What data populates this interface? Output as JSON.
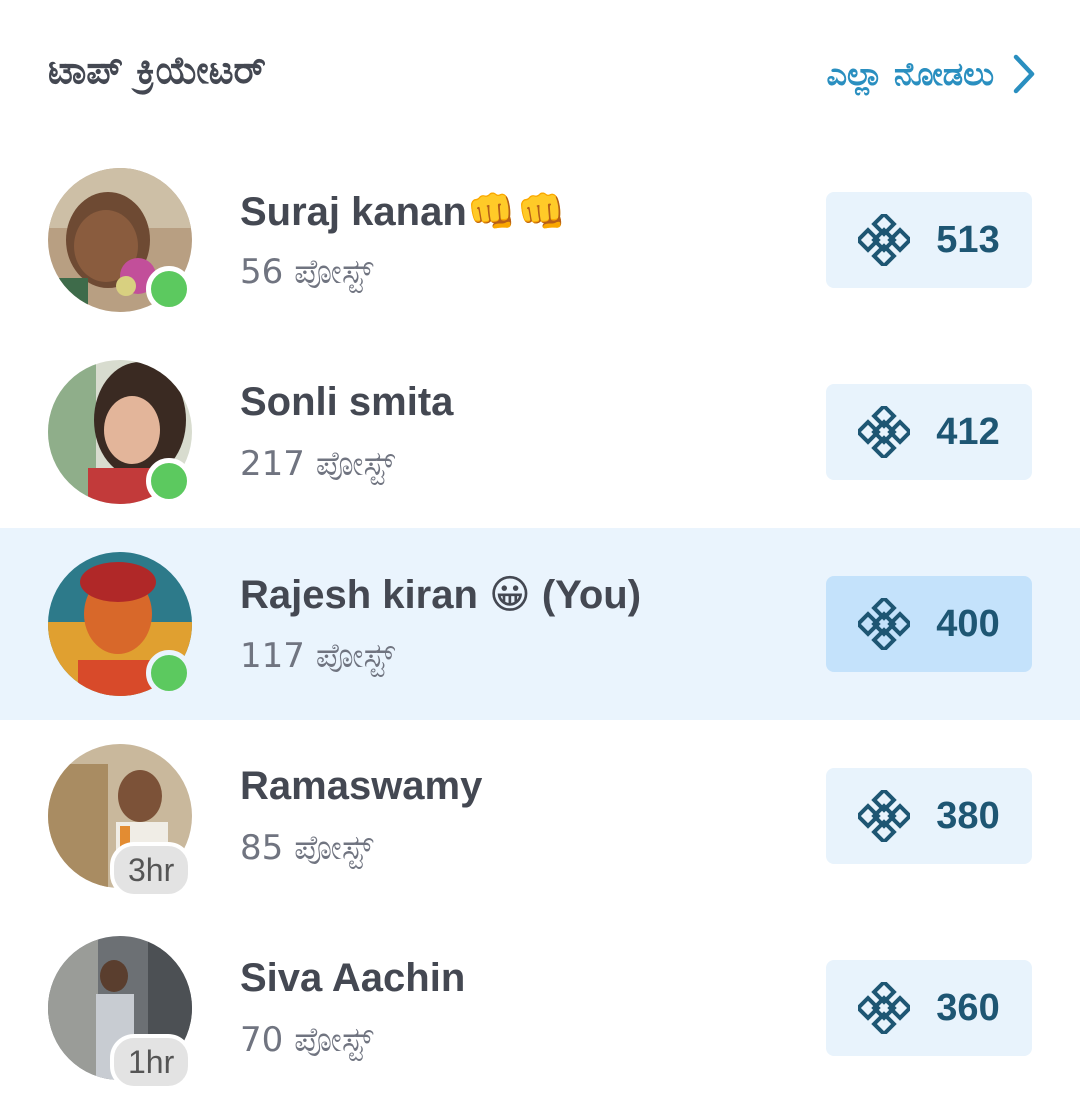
{
  "header": {
    "title": "ಟಾಪ್ ಕ್ರಿಯೇಟರ್",
    "see_all_label": "ಎಲ್ಲಾ ನೋಡಲು",
    "chevron_icon": "chevron-right-icon",
    "accent_color": "#2a8fc0"
  },
  "creators": [
    {
      "name": "Suraj kanan👊👊",
      "posts": "56 ಪೋಸ್ಟ್",
      "points": "513",
      "status": "online",
      "highlight": false
    },
    {
      "name": "Sonli smita",
      "posts": "217 ಪೋಸ್ಟ್",
      "points": "412",
      "status": "online",
      "highlight": false
    },
    {
      "name": "Rajesh kiran 😀 (You)",
      "posts": "117 ಪೋಸ್ಟ್",
      "points": "400",
      "status": "online",
      "highlight": true
    },
    {
      "name": "Ramaswamy",
      "posts": "85 ಪೋಸ್ಟ್",
      "points": "380",
      "status": "3hr",
      "highlight": false
    },
    {
      "name": "Siva Aachin",
      "posts": "70 ಪೋಸ್ಟ್",
      "points": "360",
      "status": "1hr",
      "highlight": false
    }
  ],
  "icons": {
    "points_icon": "knot-icon",
    "online_indicator": "online-dot"
  },
  "colors": {
    "online": "#5cc95f",
    "points_text": "#1e5673",
    "highlight_row": "#eaf4fd"
  }
}
